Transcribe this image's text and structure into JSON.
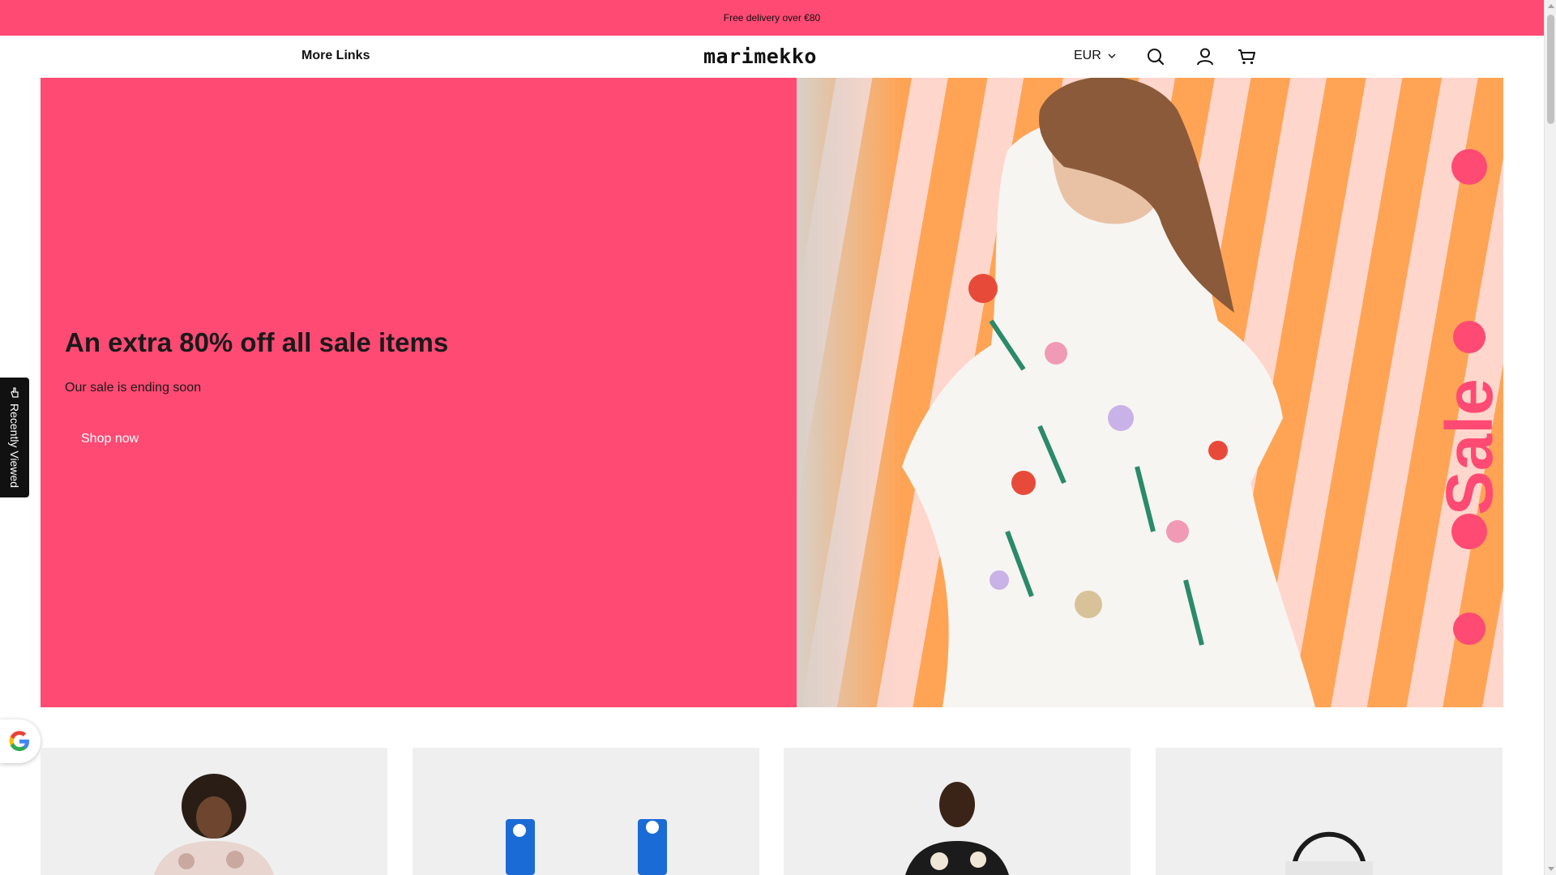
{
  "announcement": {
    "text": "Free delivery over €80"
  },
  "header": {
    "more_links_label": "More Links",
    "logo_text": "marimekko",
    "currency": "EUR",
    "icons": [
      "search-icon",
      "account-icon",
      "cart-icon"
    ]
  },
  "hero": {
    "title": "An extra 80% off all sale items",
    "subtitle": "Our sale is ending soon",
    "cta_label": "Shop now",
    "image_overlay_text": "Sale",
    "background_color": "#ff4a73"
  },
  "recently_viewed": {
    "label": "Recently Viewed"
  },
  "products": [
    {
      "image": "model-in-pink-floral-dress"
    },
    {
      "image": "blue-unikko-pattern-items"
    },
    {
      "image": "model-in-black-unikko-dress"
    },
    {
      "image": "black-white-tote-bag"
    }
  ],
  "colors": {
    "accent": "#ff4a73",
    "text": "#111111",
    "stripe_orange": "#ffa455",
    "stripe_pink": "#ffd6cc"
  }
}
